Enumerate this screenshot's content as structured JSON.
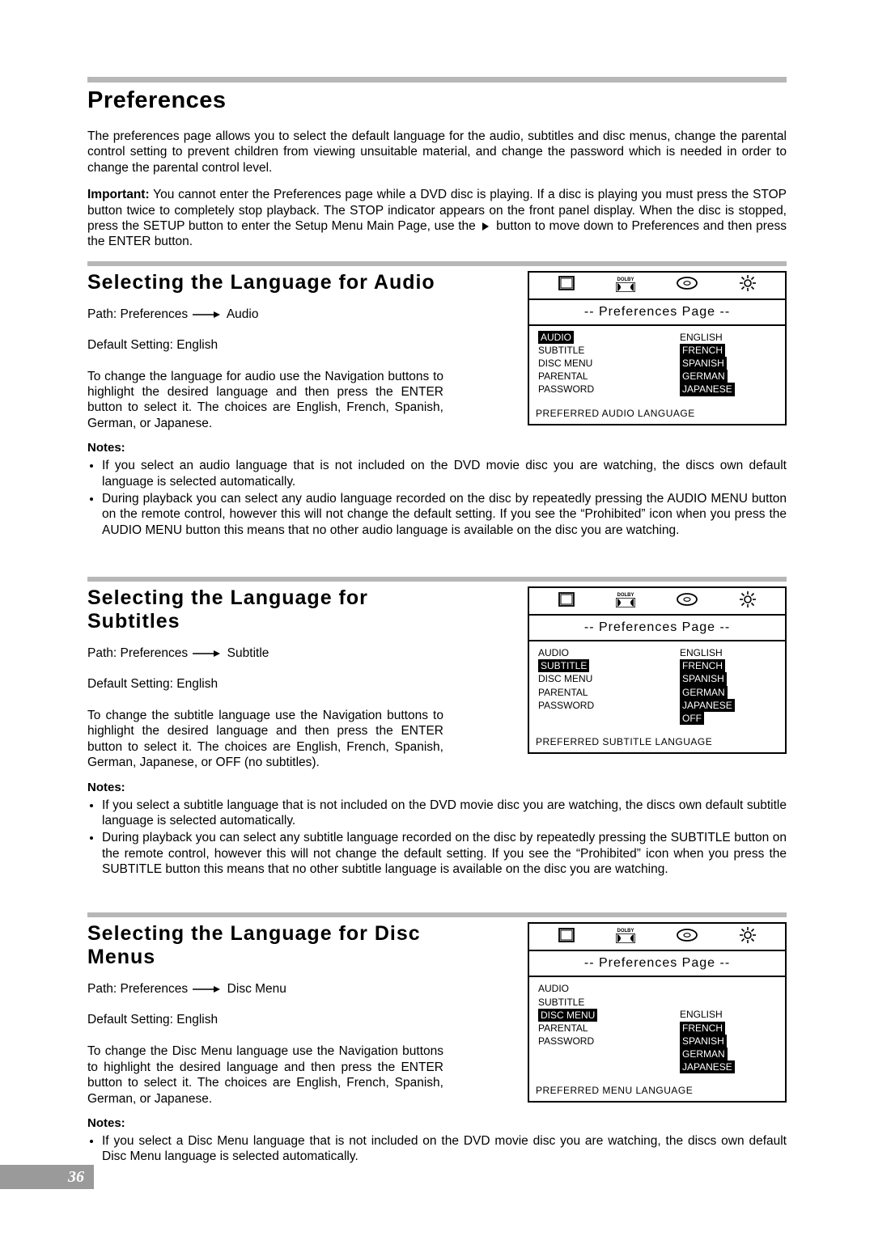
{
  "page_number": "36",
  "section_title": "Preferences",
  "intro_p1": "The preferences page allows you to select the default language for the audio, subtitles and disc menus, change the parental control setting to prevent children from viewing unsuitable material, and change the password which is needed in order to change the parental control level.",
  "important_label": "Important:",
  "important_text_a": " You cannot enter the Preferences page while a DVD disc is playing. If a disc is playing you must press the STOP button twice to completely stop playback. The STOP indicator appears on the front panel display. When the disc is stopped, press the SETUP button to enter the Setup Menu Main Page, use the ",
  "important_text_b": " button to move down to Preferences and then press the ENTER button.",
  "notes_label": "Notes:",
  "path_label": "Path: Preferences ",
  "default_label": "Default Setting: English",
  "osd_title": "-- Preferences  Page --",
  "osd_left_items": [
    "AUDIO",
    "SUBTITLE",
    "DISC MENU",
    "PARENTAL",
    "PASSWORD"
  ],
  "audio": {
    "title": "Selecting  the  Language  for  Audio",
    "path_target": " Audio",
    "body": "To change the language for audio use the Navigation buttons to highlight the desired language and then press the ENTER button to select it. The choices are English, French, Spanish, German, or Japanese.",
    "notes": [
      "If you select an audio language that is not included on the DVD movie disc you are watching, the discs own default language is selected automatically.",
      "During playback you can select any audio language recorded on the disc by repeatedly pressing the AUDIO MENU button on the remote control, however this will not change the default setting. If you see the “Prohibited” icon when you press the AUDIO MENU button this means that no other audio language is available on the disc you are watching."
    ],
    "osd_right": [
      "ENGLISH",
      "FRENCH",
      "SPANISH",
      "GERMAN",
      "JAPANESE"
    ],
    "osd_foot": "PREFERRED AUDIO LANGUAGE",
    "hl_left_index": 0,
    "hl_right_from": 1
  },
  "subtitle": {
    "title": "Selecting  the  Language  for  Subtitles",
    "path_target": " Subtitle",
    "body": "To change the subtitle language use the Navigation buttons to highlight the desired language and then press the ENTER button to select it. The choices are English, French, Spanish, German, Japanese, or OFF (no subtitles).",
    "notes": [
      "If you select a subtitle language that is not included on the DVD movie disc you are watching, the discs own default subtitle language is selected automatically.",
      "During playback you can select any subtitle language recorded on the disc by repeatedly pressing the SUBTITLE button on the remote control, however this will not change the default setting. If you see the “Prohibited” icon when you press the SUBTITLE button this means that no other subtitle language is available on the disc you are watching."
    ],
    "osd_right": [
      "ENGLISH",
      "FRENCH",
      "SPANISH",
      "GERMAN",
      "JAPANESE",
      "OFF"
    ],
    "osd_foot": "PREFERRED SUBTITLE LANGUAGE",
    "hl_left_index": 1,
    "hl_right_from": 1
  },
  "discmenu": {
    "title": "Selecting  the  Language  for  Disc  Menus",
    "path_target": " Disc Menu",
    "body": "To change the Disc Menu language use the Navigation buttons to highlight the desired language and then press the ENTER button to select it. The choices are English, French, Spanish, German, or Japanese.",
    "notes": [
      "If you select a Disc Menu language that is not included on the DVD movie disc you are watching, the discs own default Disc Menu language is selected automatically."
    ],
    "osd_right": [
      "ENGLISH",
      "FRENCH",
      "SPANISH",
      "GERMAN",
      "JAPANESE"
    ],
    "osd_foot": "PREFERRED MENU LANGUAGE",
    "hl_left_index": 2,
    "hl_right_from": 1
  }
}
